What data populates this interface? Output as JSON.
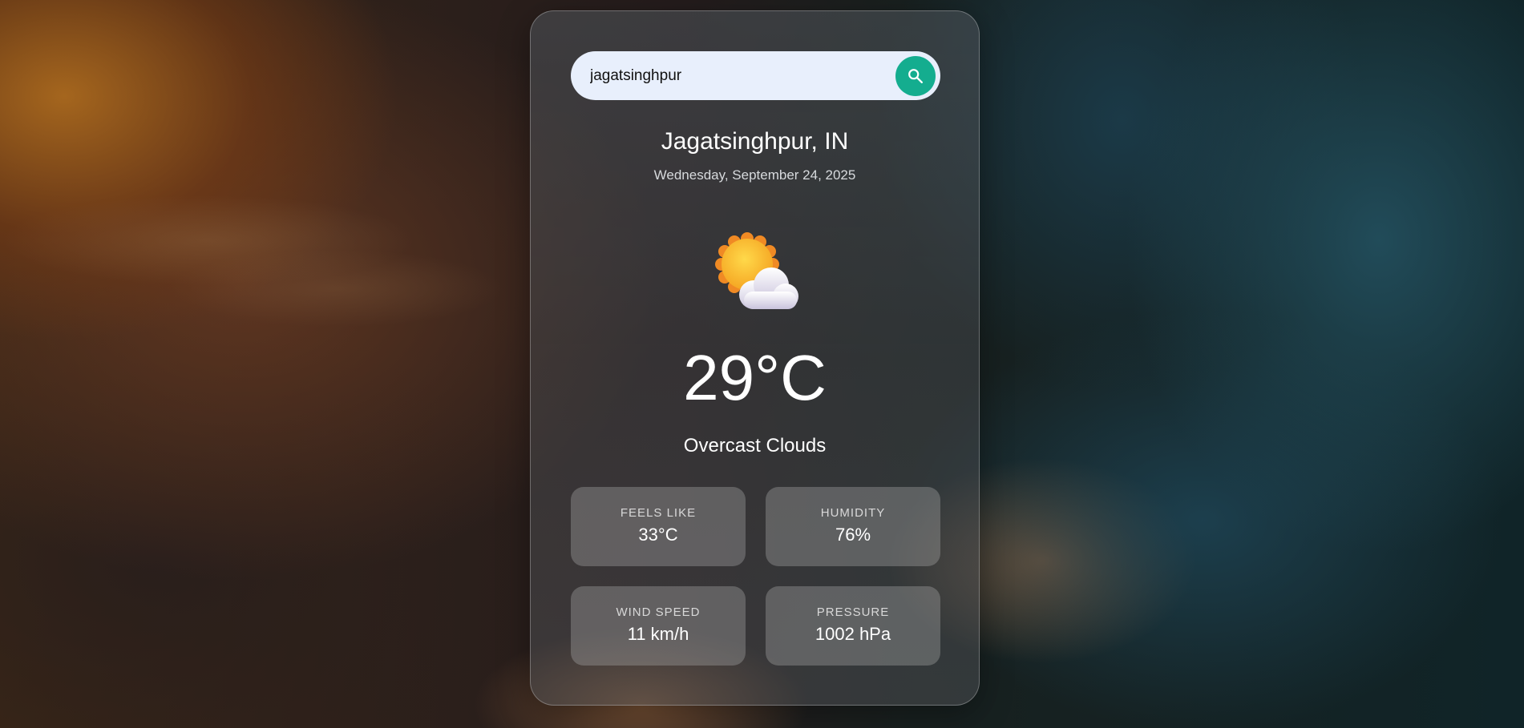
{
  "search": {
    "value": "jagatsinghpur",
    "icon": "search-icon"
  },
  "location": {
    "city": "Jagatsinghpur, IN",
    "date": "Wednesday, September 24, 2025"
  },
  "current": {
    "icon": "sun-behind-cloud-icon",
    "temperature": "29°C",
    "description": "Overcast Clouds"
  },
  "stats": [
    {
      "label": "FEELS LIKE",
      "value": "33°C"
    },
    {
      "label": "HUMIDITY",
      "value": "76%"
    },
    {
      "label": "WIND SPEED",
      "value": "11 km/h"
    },
    {
      "label": "PRESSURE",
      "value": "1002 hPa"
    }
  ],
  "colors": {
    "accent": "#14ad8f",
    "search_bg": "#e8effc",
    "text": "#ffffff"
  }
}
